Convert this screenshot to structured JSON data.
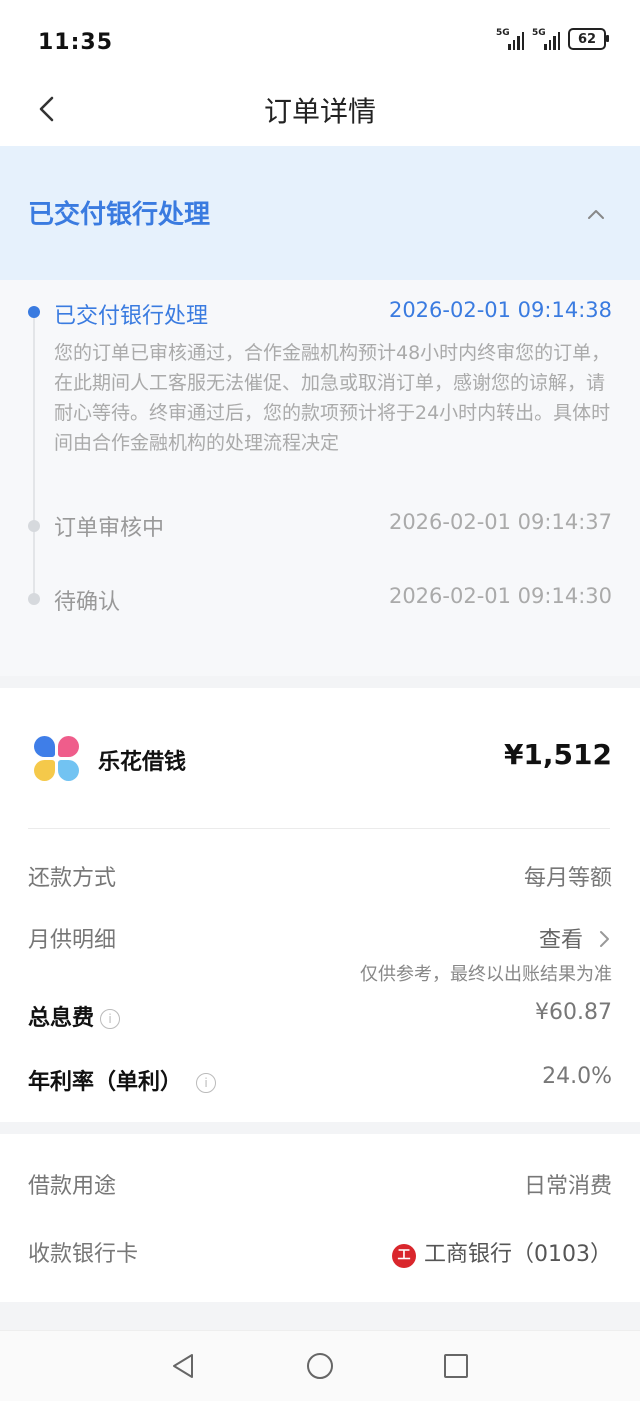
{
  "status_bar": {
    "time": "11:35",
    "signal1": "5G",
    "signal2": "5G",
    "battery": "62"
  },
  "nav": {
    "title": "订单详情",
    "back_icon": "chevron-left-icon"
  },
  "status_header": {
    "title": "已交付银行处理",
    "toggle_icon": "chevron-up-icon"
  },
  "timeline": [
    {
      "title": "已交付银行处理",
      "time": "2026-02-01 09:14:38",
      "active": true,
      "desc": "您的订单已审核通过，合作金融机构预计48小时内终审您的订单，在此期间人工客服无法催促、加急或取消订单，感谢您的谅解，请耐心等待。终审通过后，您的款项预计将于24小时内转出。具体时间由合作金融机构的处理流程决定"
    },
    {
      "title": "订单审核中",
      "time": "2026-02-01 09:14:37",
      "active": false
    },
    {
      "title": "待确认",
      "time": "2026-02-01 09:14:30",
      "active": false
    }
  ],
  "loan": {
    "brand": "乐花借钱",
    "amount": "¥1,512",
    "repay_method_label": "还款方式",
    "repay_method_value": "每月等额",
    "monthly_label": "月供明细",
    "monthly_action": "查看",
    "monthly_note": "仅供参考，最终以出账结果为准",
    "interest_label": "总息费",
    "interest_value": "¥60.87",
    "rate_label": "年利率（单利）",
    "rate_value": "24.0%",
    "info_glyph": "i"
  },
  "details": {
    "purpose_label": "借款用途",
    "purpose_value": "日常消费",
    "card_label": "收款银行卡",
    "card_value": "工商银行（0103）",
    "bank_glyph": "工"
  },
  "colors": {
    "accent": "#3a7be0",
    "header_bg": "#e6f1fc",
    "bank_red": "#d9262c"
  }
}
